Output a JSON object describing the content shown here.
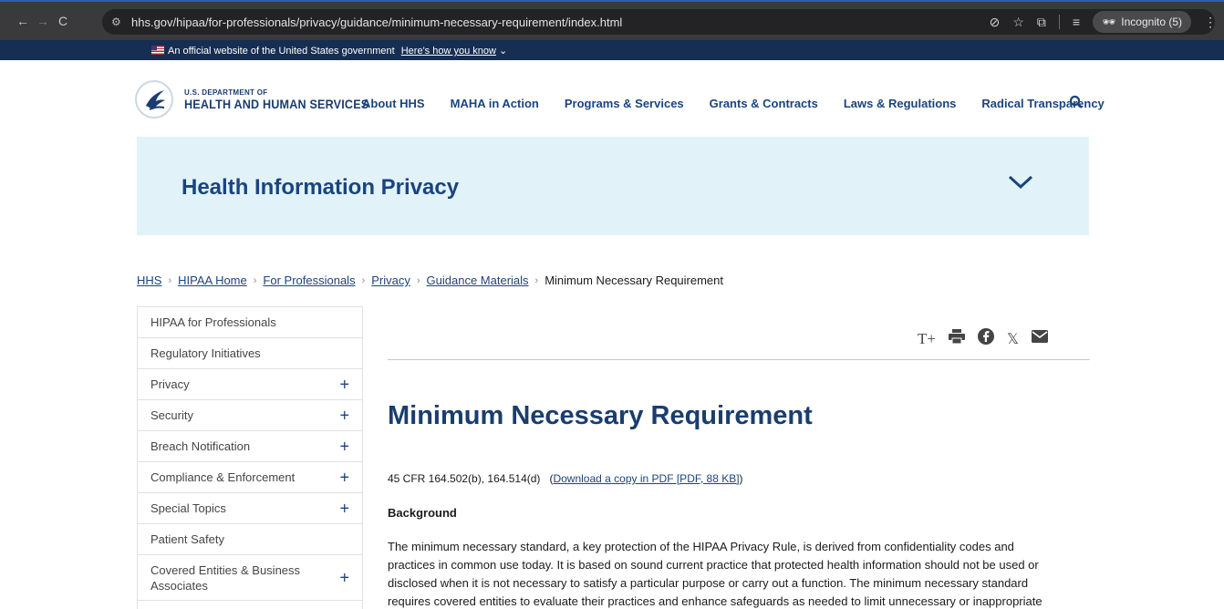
{
  "browser": {
    "url": "hhs.gov/hipaa/for-professionals/privacy/guidance/minimum-necessary-requirement/index.html",
    "incognito_label": "Incognito (5)"
  },
  "gov_banner": {
    "text": "An official website of the United States government",
    "link": "Here's how you know"
  },
  "header": {
    "logo_small": "U.S. DEPARTMENT OF",
    "logo_big": "HEALTH AND HUMAN SERVICES",
    "nav": [
      "About HHS",
      "MAHA in Action",
      "Programs & Services",
      "Grants & Contracts",
      "Laws & Regulations",
      "Radical Transparency"
    ]
  },
  "hero": {
    "title": "Health Information Privacy"
  },
  "breadcrumb": {
    "links": [
      "HHS",
      "HIPAA Home",
      "For Professionals",
      "Privacy",
      "Guidance Materials"
    ],
    "current": "Minimum Necessary Requirement"
  },
  "sidebar": {
    "items": [
      {
        "label": "HIPAA for Professionals",
        "expandable": false
      },
      {
        "label": "Regulatory Initiatives",
        "expandable": false
      },
      {
        "label": "Privacy",
        "expandable": true
      },
      {
        "label": "Security",
        "expandable": true
      },
      {
        "label": "Breach Notification",
        "expandable": true
      },
      {
        "label": "Compliance & Enforcement",
        "expandable": true
      },
      {
        "label": "Special Topics",
        "expandable": true
      },
      {
        "label": "Patient Safety",
        "expandable": false
      },
      {
        "label": "Covered Entities & Business Associates",
        "expandable": true
      }
    ]
  },
  "content": {
    "title": "Minimum Necessary Requirement",
    "cfr_text": "45 CFR 164.502(b), 164.514(d)",
    "cfr_link": "Download a copy in PDF [PDF, 88 KB]",
    "background_heading": "Background",
    "body_lines": [
      "The minimum necessary standard, a key protection of the HIPAA Privacy Rule, is derived from confidentiality codes and",
      "practices in common use today. It is based on sound current practice that protected health information should not be used or",
      "disclosed when it is not necessary to satisfy a particular purpose or carry out a function. The minimum necessary standard",
      "requires covered entities to evaluate their practices and enhance safeguards as needed to limit unnecessary or inappropriate"
    ]
  },
  "icons": {
    "text_size": "T+",
    "print": "🖶",
    "facebook": "f",
    "x": "𝕏",
    "email": "✉"
  },
  "colors": {
    "navy": "#1a4480",
    "banner": "#162e51",
    "hero_bg": "#e1f3f8"
  }
}
